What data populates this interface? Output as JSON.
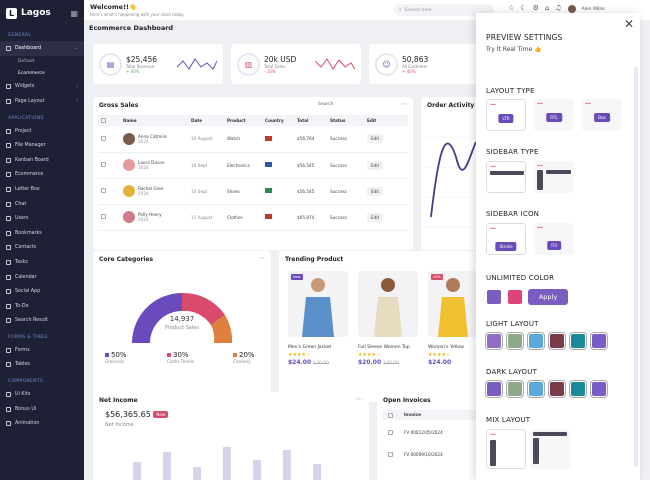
{
  "brand": {
    "name": "Lagos"
  },
  "sidebar": {
    "sections": {
      "general": "GENERAL",
      "applications": "APPLICATIONS",
      "forms": "FORMS & TABLE",
      "components": "COMPONENTS"
    },
    "dashboard": "Dashboard",
    "dashboard_sub": [
      "Default",
      "Ecommerce"
    ],
    "items_general": [
      "Widgets",
      "Page Layout"
    ],
    "items_apps": [
      "Project",
      "File Manager",
      "Kanban Board",
      "Ecommerce",
      "Letter Box",
      "Chat",
      "Users",
      "Bookmarks",
      "Contacts",
      "Tasks",
      "Calendar",
      "Social App",
      "To-Do",
      "Search Result"
    ],
    "items_forms": [
      "Forms",
      "Tables"
    ],
    "items_components": [
      "Ui Kits",
      "Bonus Ui",
      "Animation"
    ]
  },
  "header": {
    "title": "Welcome!!",
    "emoji": "👋",
    "subtitle": "Here's what's happening with your store today.",
    "search_placeholder": "Search here",
    "user": "Alen Miller"
  },
  "page": {
    "title": "Ecommerce Dashboard"
  },
  "stats": [
    {
      "value": "$25,456",
      "label": "Total Revenue",
      "delta": "+ 40%",
      "color": "#5aab6a"
    },
    {
      "value": "20k USD",
      "label": "Total Sales",
      "delta": "- 10%",
      "color": "#d94b6b"
    },
    {
      "value": "50,863",
      "label": "All Customer",
      "delta": "+ 40%",
      "color": "#d94b6b"
    }
  ],
  "gross_sales": {
    "title": "Gross Sales",
    "search": "Search",
    "columns": [
      "Name",
      "Date",
      "Product",
      "Country",
      "Total",
      "Status",
      "Edit"
    ],
    "rows": [
      {
        "name": "Anna Catmire",
        "year": "2024",
        "date": "10 August",
        "product": "Watch",
        "total": "$56,764",
        "status": "Success",
        "edit": "Edit",
        "avatar": "#7a5a4a",
        "flag": "#c0392b"
      },
      {
        "name": "Laura Dacon",
        "year": "2024",
        "date": "10 Sept",
        "product": "Electronics",
        "total": "$56,545",
        "status": "Success",
        "edit": "Edit",
        "avatar": "#e59aa0",
        "flag": "#2e5aa8"
      },
      {
        "name": "Rachel Gree",
        "year": "2024",
        "date": "10 Sept",
        "product": "Shoes",
        "total": "$56,545",
        "status": "Success",
        "edit": "Edit",
        "avatar": "#e2b23a",
        "flag": "#2a8a4a"
      },
      {
        "name": "Polly Heery",
        "year": "2024",
        "date": "11 August",
        "product": "Clothes",
        "total": "$65,874",
        "status": "Success",
        "edit": "Edit",
        "avatar": "#d07a8a",
        "flag": "#c0392b"
      }
    ]
  },
  "order_activity": {
    "title": "Order Activity"
  },
  "core_categories": {
    "title": "Core Categories",
    "total": "14,937",
    "total_label": "Product Sales",
    "legend": [
      {
        "value": "50%",
        "label": "Groceries",
        "color": "#6a4bbc"
      },
      {
        "value": "30%",
        "label": "Cloths Trends",
        "color": "#d94b6b"
      },
      {
        "value": "20%",
        "label": "Crockery",
        "color": "#e08040"
      }
    ]
  },
  "trending": {
    "title": "Trending Product",
    "items": [
      {
        "name": "Men's Green Jacket",
        "stars": "★★★★☆",
        "price": "$24.00",
        "old": "$30.00",
        "badge": "New"
      },
      {
        "name": "Full Sleeve Women Top",
        "stars": "★★★★☆",
        "price": "$20.00",
        "old": "$30.00",
        "badge": ""
      },
      {
        "name": "Women's Yellow",
        "stars": "★★★★☆",
        "price": "$24.00",
        "old": "",
        "badge": "20%"
      }
    ]
  },
  "net_income": {
    "title": "Net Income",
    "value": "$56,365.65",
    "badge": "New",
    "label": "Net Income"
  },
  "open_invoices": {
    "title": "Open Invoices",
    "column": "Invoice",
    "rows": [
      "FV 00012/05/2024",
      "FV 00009/10/2024"
    ]
  },
  "preview": {
    "title": "PREVIEW SETTINGS",
    "subtitle": "Try It Real Time",
    "layout_type": {
      "title": "LAYOUT TYPE",
      "options": [
        "LTR",
        "RTL",
        "Box"
      ]
    },
    "sidebar_type": {
      "title": "SIDEBAR TYPE"
    },
    "sidebar_icon": {
      "title": "SIDEBAR ICON",
      "options": [
        "Stroke",
        "Fill"
      ]
    },
    "unlimited_color": {
      "title": "UNLIMITED COLOR",
      "apply": "Apply",
      "colors": [
        "#7b5cc0",
        "#e0427a"
      ]
    },
    "light_layout": {
      "title": "LIGHT LAYOUT",
      "colors": [
        "#8e6fc4",
        "#8fa98a",
        "#5aa9d9",
        "#7a3a4a",
        "#1a8a9a",
        "#7a5cc7"
      ]
    },
    "dark_layout": {
      "title": "DARK LAYOUT",
      "colors": [
        "#7b5cc0",
        "#8fa98a",
        "#5aa9d9",
        "#7a3a4a",
        "#1a8a9a",
        "#7a5cc7"
      ]
    },
    "mix_layout": {
      "title": "MIX LAYOUT"
    }
  }
}
